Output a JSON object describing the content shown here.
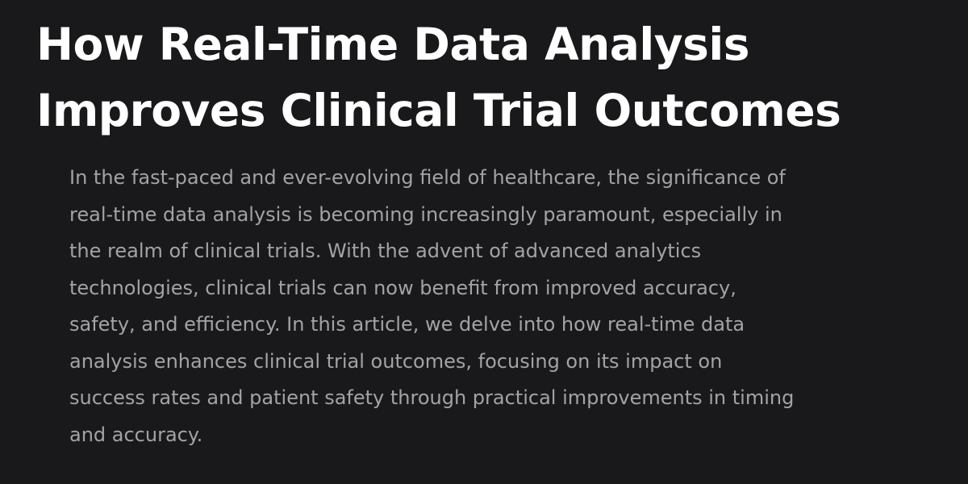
{
  "article": {
    "title_lines": [
      "How Real-Time Data Analysis",
      "Improves Clinical Trial Outcomes"
    ],
    "intro_lines": [
      "In the fast-paced and ever-evolving field of healthcare, the significance of",
      "real-time data analysis is becoming increasingly paramount, especially in",
      "the realm of clinical trials. With the advent of advanced analytics",
      "technologies, clinical trials can now benefit from improved accuracy,",
      "safety, and efficiency. In this article, we delve into how real-time data",
      "analysis enhances clinical trial outcomes, focusing on its impact on",
      "success rates and patient safety through practical improvements in timing",
      "and accuracy."
    ]
  },
  "colors": {
    "background": "#19191b",
    "title": "#ffffff",
    "body": "#a3a3a6"
  }
}
